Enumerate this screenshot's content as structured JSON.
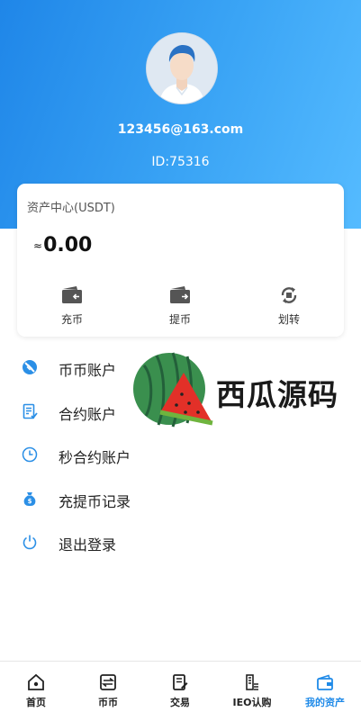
{
  "profile": {
    "email": "123456@163.com",
    "id_text": "ID:75316"
  },
  "assets": {
    "title": "资产中心(USDT)",
    "approx_symbol": "≈",
    "balance": "0.00",
    "actions": [
      {
        "label": "充币",
        "icon": "wallet-deposit-icon"
      },
      {
        "label": "提币",
        "icon": "wallet-withdraw-icon"
      },
      {
        "label": "划转",
        "icon": "transfer-icon"
      }
    ]
  },
  "menu": [
    {
      "label": "币币账户",
      "icon": "no-coin-icon"
    },
    {
      "label": "合约账户",
      "icon": "document-icon"
    },
    {
      "label": "秒合约账户",
      "icon": "clock-icon"
    },
    {
      "label": "充提币记录",
      "icon": "money-bag-icon"
    },
    {
      "label": "退出登录",
      "icon": "power-icon"
    }
  ],
  "watermark": {
    "text": "西瓜源码"
  },
  "tabs": [
    {
      "label": "首页",
      "icon": "home-icon"
    },
    {
      "label": "币币",
      "icon": "exchange-icon"
    },
    {
      "label": "交易",
      "icon": "trade-icon"
    },
    {
      "label": "IEO认购",
      "icon": "ieo-icon"
    },
    {
      "label": "我的资产",
      "icon": "wallet-icon",
      "active": true
    }
  ],
  "colors": {
    "accent": "#1f8ae8",
    "hero_start": "#1f86e8",
    "hero_end": "#55bbff",
    "icon_gray": "#666666"
  }
}
